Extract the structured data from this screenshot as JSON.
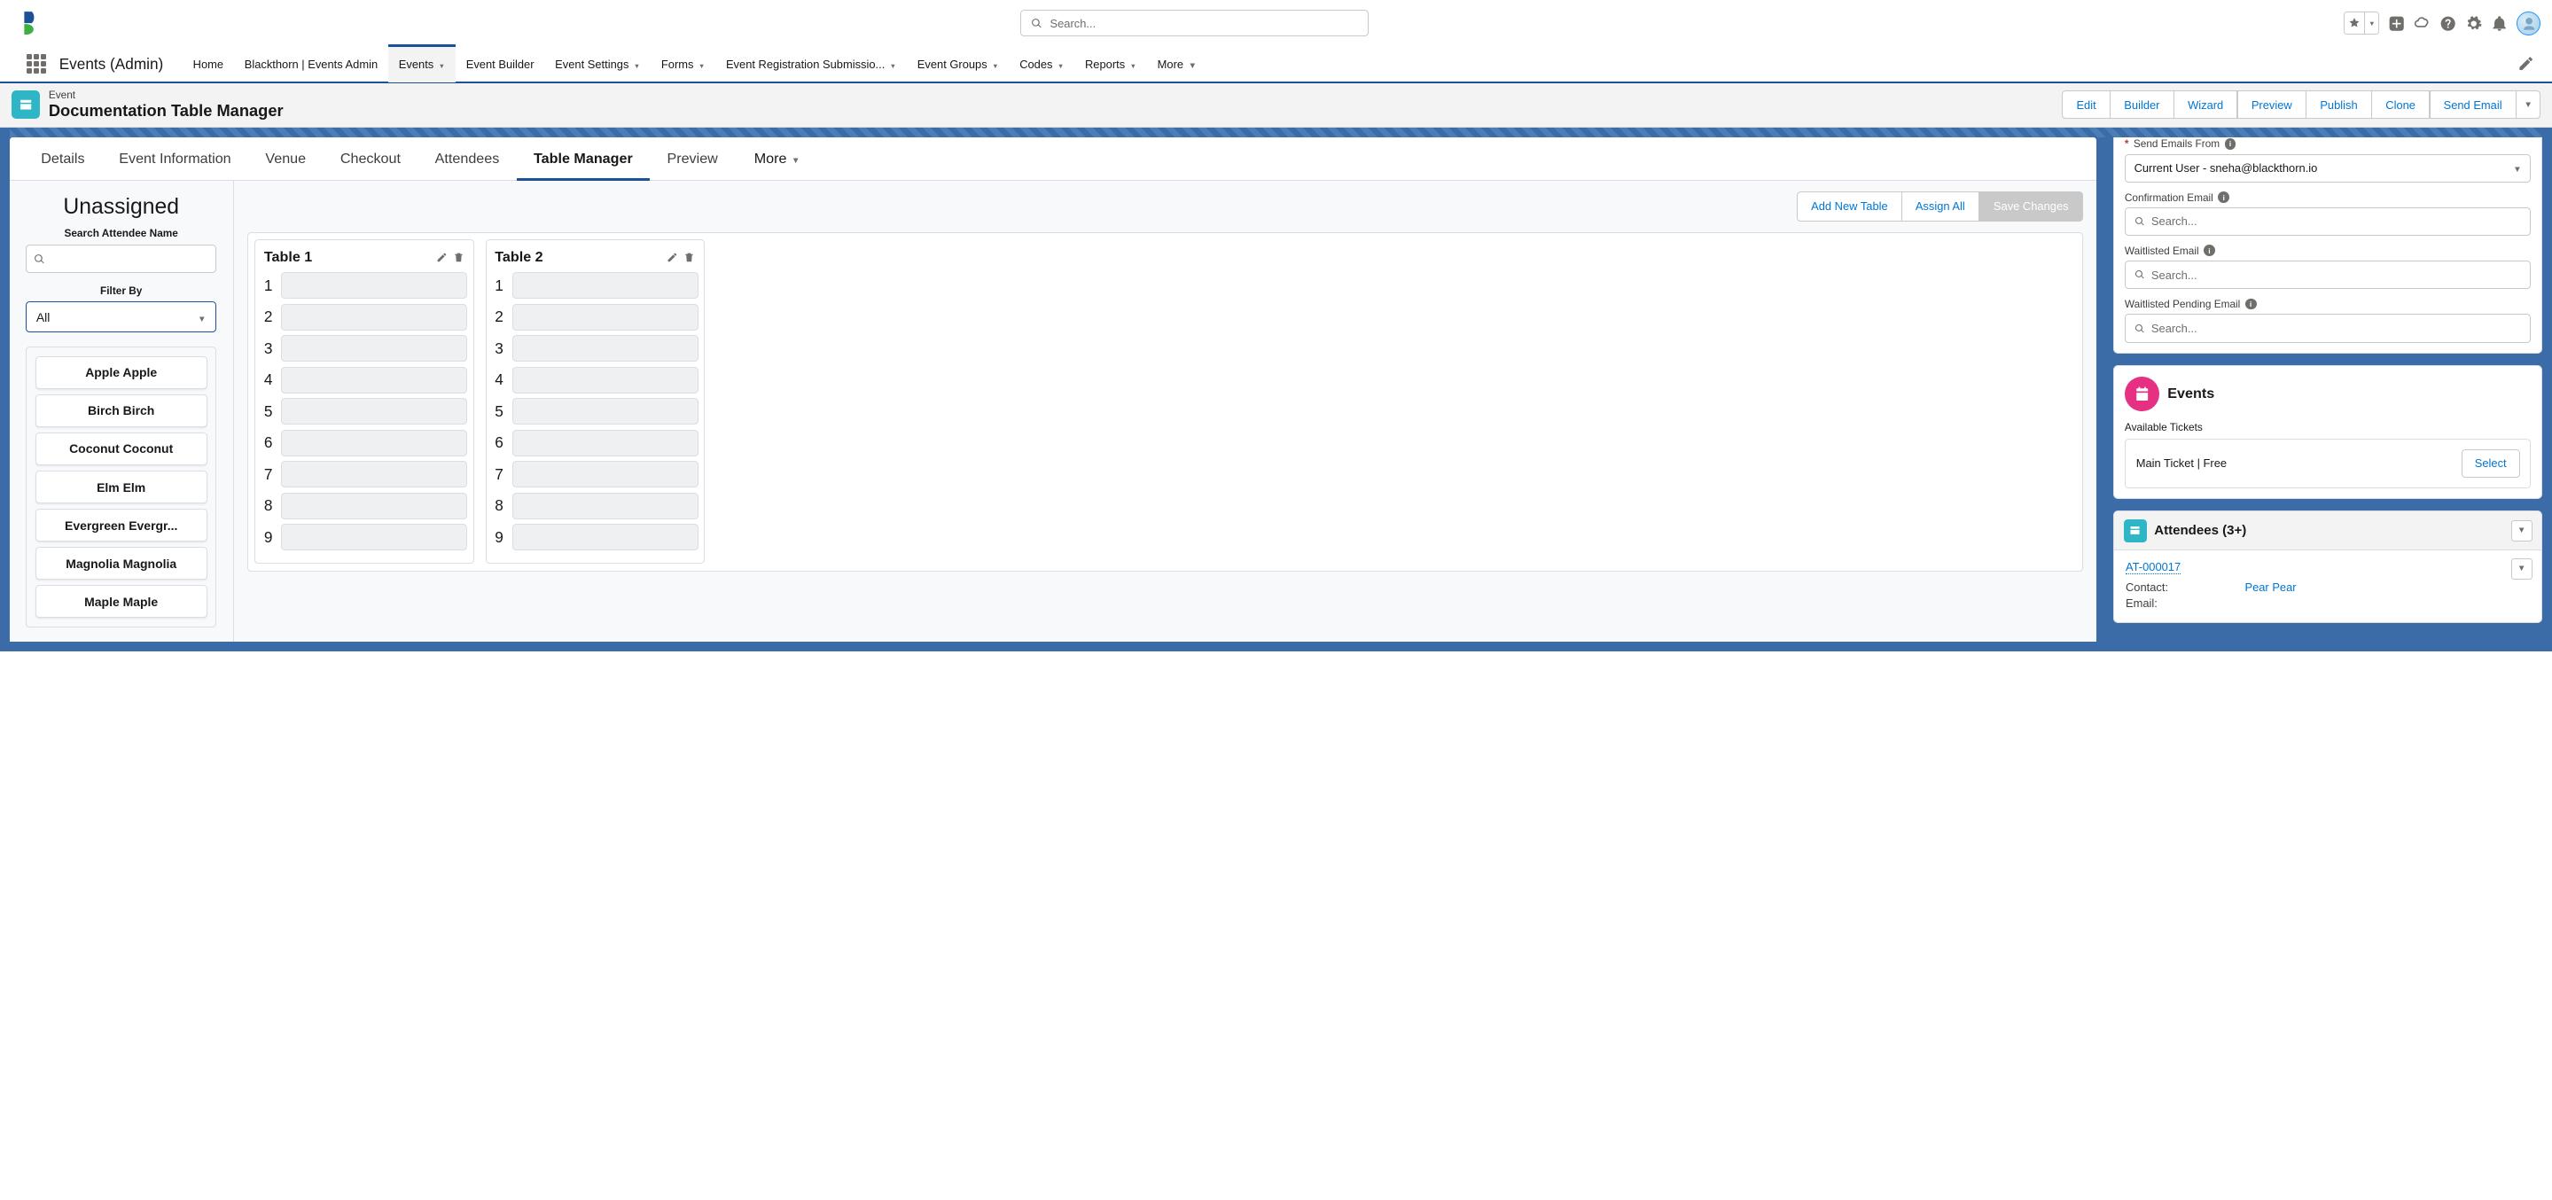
{
  "topbar": {
    "search_placeholder": "Search..."
  },
  "nav": {
    "app_name": "Events (Admin)",
    "items": [
      "Home",
      "Blackthorn | Events Admin",
      "Events",
      "Event Builder",
      "Event Settings",
      "Forms",
      "Event Registration Submissio...",
      "Event Groups",
      "Codes",
      "Reports",
      "More"
    ],
    "active_index": 2
  },
  "header": {
    "object_type": "Event",
    "title": "Documentation Table Manager",
    "actions": [
      "Edit",
      "Builder",
      "Wizard",
      "Preview",
      "Publish",
      "Clone",
      "Send Email"
    ]
  },
  "inner_tabs": {
    "items": [
      "Details",
      "Event Information",
      "Venue",
      "Checkout",
      "Attendees",
      "Table Manager",
      "Preview"
    ],
    "active_index": 5,
    "more": "More"
  },
  "unassigned": {
    "title": "Unassigned",
    "search_label": "Search Attendee Name",
    "filter_label": "Filter By",
    "filter_value": "All",
    "attendees": [
      "Apple Apple",
      "Birch Birch",
      "Coconut Coconut",
      "Elm Elm",
      "Evergreen Evergr...",
      "Magnolia Magnolia",
      "Maple Maple"
    ]
  },
  "tables_area": {
    "add_new": "Add New Table",
    "assign_all": "Assign All",
    "save": "Save Changes",
    "tables": [
      {
        "name": "Table 1",
        "seats": 9
      },
      {
        "name": "Table 2",
        "seats": 9
      }
    ]
  },
  "email_panel": {
    "send_from_label": "Send Emails From",
    "send_from_value": "Current User - sneha@blackthorn.io",
    "confirmation_label": "Confirmation Email",
    "waitlisted_label": "Waitlisted Email",
    "waitlisted_pending_label": "Waitlisted Pending Email",
    "search_placeholder": "Search..."
  },
  "events_panel": {
    "title": "Events",
    "available_label": "Available Tickets",
    "ticket": "Main Ticket | Free",
    "select": "Select"
  },
  "attendees_panel": {
    "title": "Attendees (3+)",
    "record": {
      "id": "AT-000017",
      "contact_label": "Contact:",
      "contact_value": "Pear Pear",
      "email_label": "Email:"
    }
  }
}
